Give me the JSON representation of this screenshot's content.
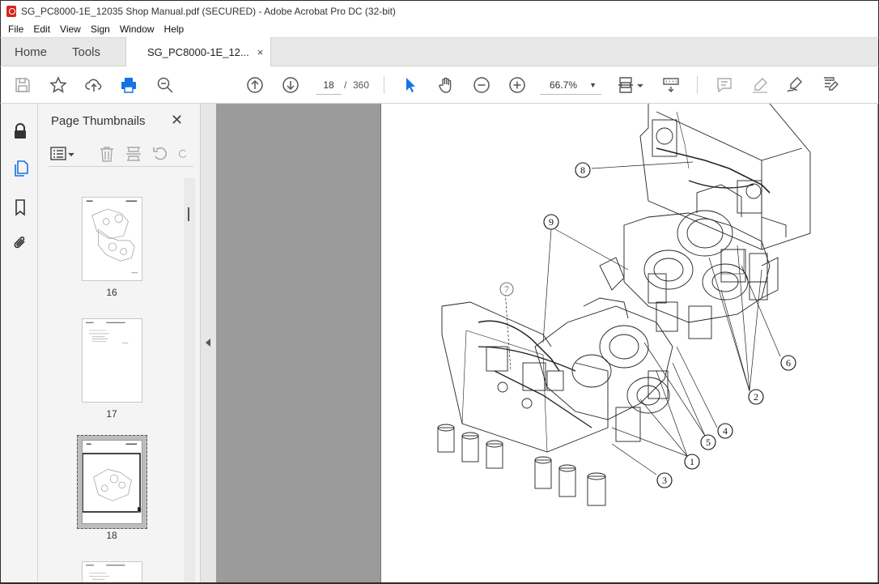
{
  "window": {
    "title": "SG_PC8000-1E_12035 Shop Manual.pdf (SECURED) - Adobe Acrobat Pro DC (32-bit)"
  },
  "menu": [
    "File",
    "Edit",
    "View",
    "Sign",
    "Window",
    "Help"
  ],
  "tabs": {
    "home": "Home",
    "tools": "Tools",
    "document": "SG_PC8000-1E_12...",
    "close_symbol": "×"
  },
  "toolbar": {
    "current_page": "18",
    "page_separator": "/",
    "total_pages": "360",
    "zoom": "66.7%"
  },
  "thumbnails_panel": {
    "title": "Page Thumbnails",
    "close_symbol": "✕",
    "pages": [
      {
        "label": "16"
      },
      {
        "label": "17"
      },
      {
        "label": "18",
        "selected": true
      }
    ]
  },
  "drawing": {
    "callouts": [
      "8",
      "9",
      "7",
      "6",
      "2",
      "4",
      "5",
      "1",
      "3"
    ]
  },
  "colors": {
    "viewport_bg": "#9b9b9b",
    "accent_red": "#d7251b",
    "selection_blue": "#1473e6"
  }
}
